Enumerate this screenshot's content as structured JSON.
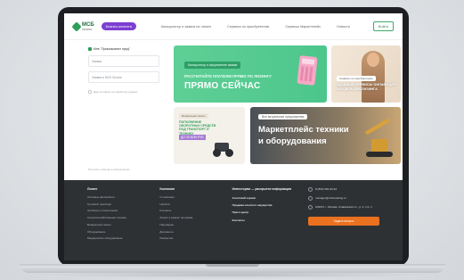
{
  "header": {
    "logo_text": "МСБ",
    "logo_sub": "ЛИЗИНГ",
    "pill_label": "Бизнес-клиента",
    "nav": [
      "Калькулятор и заявка на лизинг",
      "Сервисы по приобретению",
      "Сервисы Маркетплейс",
      "Новости"
    ],
    "login_label": "Войти"
  },
  "left_panel": {
    "title": "Мне \"Приказывают пред\"",
    "field1_placeholder": "Заявка",
    "field2_placeholder": "Заявка в МСБ Лизинг",
    "checkbox_label": "Даю согласие на обработку данных",
    "footnote": "Получить помощь в оформлении"
  },
  "banners": {
    "b1": {
      "tag": "Калькулятор и оформление заявки",
      "line1": "РАССЧИТАЙТЕ ПЛАТЕЖИ ПРЯМО ПО ЛИЗИНГУ",
      "line2": "ПРЯМО СЕЙЧАС"
    },
    "b2": {
      "tag": "Сервисы по приобретению",
      "text": "УДОБНЫЕ СЕРВИСЫ ОНЛАЙН ДЛЯ ВЛАДЕЛЬЦЕВ ЛИЗИНГА"
    },
    "b3": {
      "tag": "Возвратный лизинг",
      "text": "ПОПОЛНЕНИЕ ОБОРОТНЫХ СРЕДСТВ ПОД ТРАНСПОРТ И ТЕХНИКУ",
      "highlight": "ДО 30 МЛН РУБ"
    },
    "b4": {
      "tag": "Все актуальные предложения",
      "title1": "Маркетплейс техники",
      "title2": "и оборудования"
    }
  },
  "footer": {
    "col1": {
      "heading": "Лизинг",
      "items": [
        "Легковые автомобили",
        "Грузовой транспорт",
        "Автобусы и спецтехника",
        "Сельскохозяйственная техника",
        "Возвратный лизинг",
        "Оборудование",
        "Медицинское оборудование"
      ]
    },
    "col2": {
      "heading": "Компания",
      "items": [
        "О компании",
        "Новости",
        "Контакты",
        "Лизинг в рамках программ",
        "Партнёрам",
        "Документы",
        "Раскрытие"
      ]
    },
    "col3": {
      "heading": "Инвесторам — раскрытие информации",
      "items": [
        "Агентский сервис",
        "Продажа изъятого имущества",
        "Пресс-центр",
        "Контакты"
      ]
    },
    "contact": {
      "phone": "8 (800) 500-93-94",
      "email": "manager@msb-leasing.ru",
      "address": "109074, г. Москва, Славянская пл., д. 4, стр. 1",
      "button": "Задать вопрос"
    }
  },
  "colors": {
    "accent_green": "#2f9e58",
    "pill_purple": "#7b3fd1",
    "order_orange": "#e9711f",
    "footer_bg": "#2e3134"
  }
}
